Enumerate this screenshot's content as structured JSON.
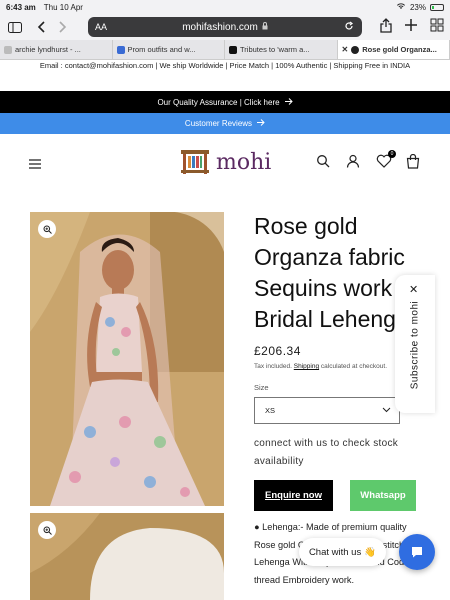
{
  "status_bar": {
    "time": "6:43 am",
    "date": "Thu 10 Apr",
    "battery": "23%",
    "battery_level": 0.23
  },
  "browser": {
    "text_size_label": "AA",
    "url": "mohifashion.com",
    "tabs": [
      {
        "label": "archie lyndhurst - ..."
      },
      {
        "label": "Prom outfits and w..."
      },
      {
        "label": "Tributes to 'warm a..."
      },
      {
        "label": "Rose gold Organza..."
      }
    ]
  },
  "announcement": {
    "info_line": "Email : contact@mohifashion.com | We ship Worldwide | Price Match | 100% Authentic | Shipping Free in INDIA",
    "quality_bar": "Our Quality Assurance | Click here",
    "reviews_bar": "Customer Reviews"
  },
  "header": {
    "logo_text": "mohi",
    "cart_count": "0"
  },
  "product": {
    "title_lines": [
      "Rose gold",
      "Organza fabric",
      "Sequins work",
      "Bridal Lehenga"
    ],
    "price": "£206.34",
    "tax_prefix": "Tax included.",
    "tax_link": "Shipping",
    "tax_suffix": "calculated at checkout.",
    "size_label": "Size",
    "size_value": "XS",
    "connect_text": "connect with us to check stock availability",
    "enquire_label": "Enquire now",
    "whatsapp_label": "Whatsapp",
    "description": "● Lehenga:- Made of premium quality Rose gold Organza fabric Fully stitched Lehenga With sequins work and Coding thread Embroidery work."
  },
  "subscribe": {
    "label": "Subscribe to mohi"
  },
  "chat": {
    "label": "Chat with us",
    "emoji": "👋"
  },
  "colors": {
    "black_bar": "#000000",
    "blue_bar": "#3e8ce8",
    "whatsapp": "#5ec96c",
    "chat_button": "#2f6de1",
    "logo": "#5b2a62"
  }
}
